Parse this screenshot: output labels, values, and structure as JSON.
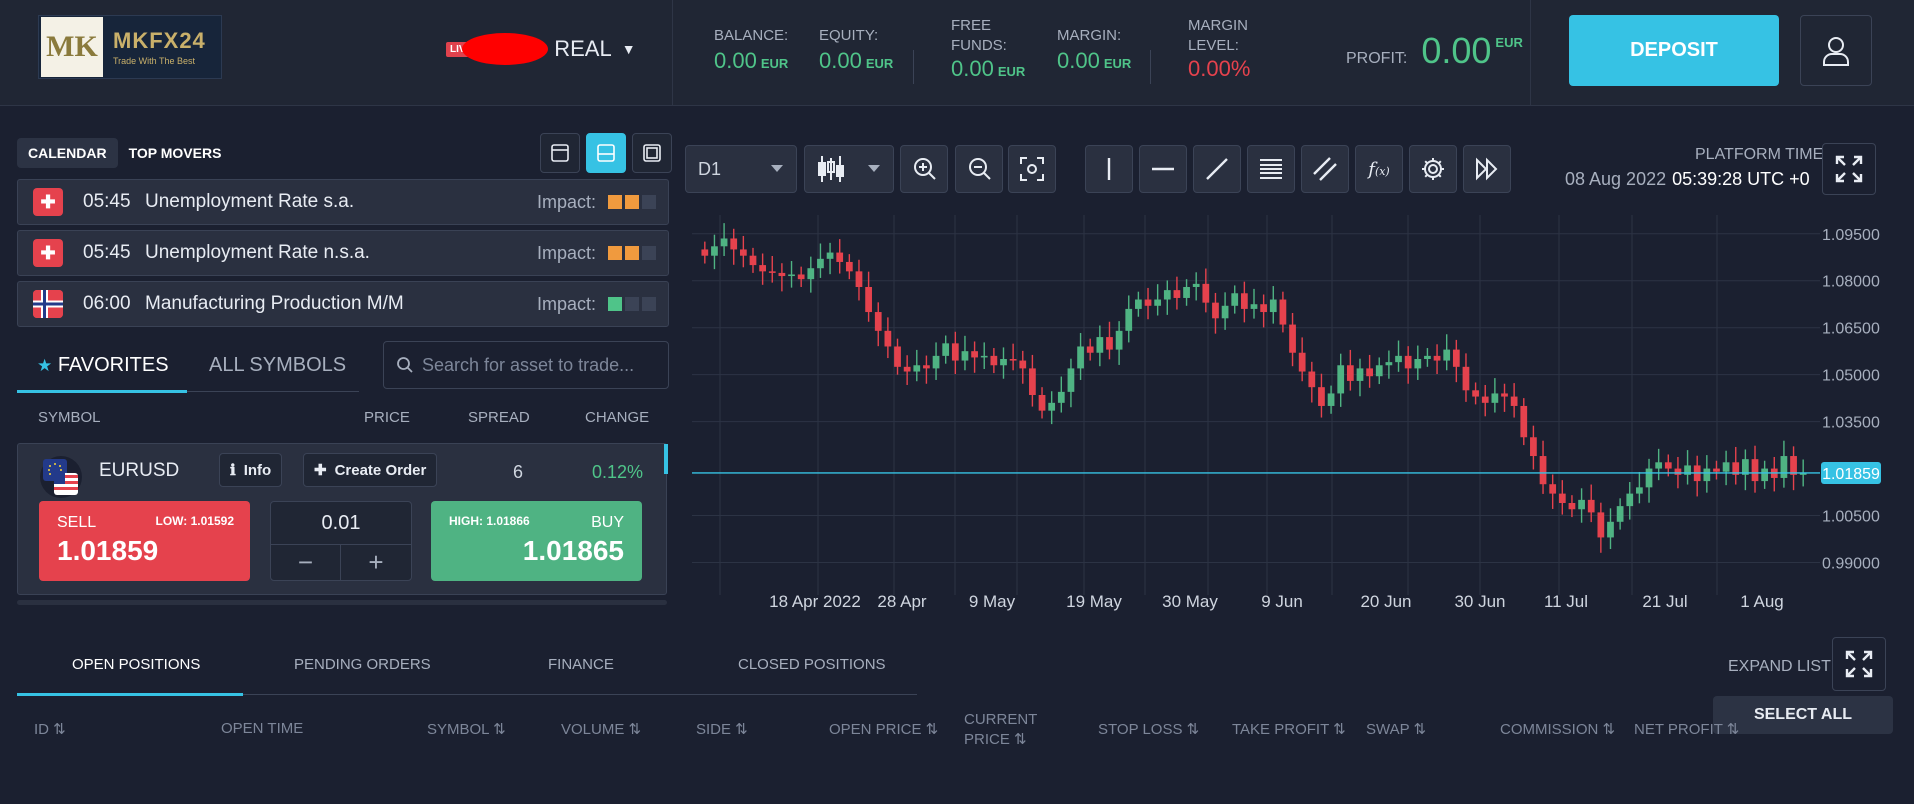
{
  "logo": {
    "title": "MKFX24",
    "tagline": "Trade With The Best",
    "mark": "MK"
  },
  "account": {
    "badge": "LIVE",
    "type": "REAL",
    "caret": "▼"
  },
  "stats": {
    "balance": {
      "label": "BALANCE:",
      "value": "0.00",
      "currency": "EUR"
    },
    "equity": {
      "label": "EQUITY:",
      "value": "0.00",
      "currency": "EUR"
    },
    "free_funds": {
      "label1": "FREE",
      "label2": "FUNDS:",
      "value": "0.00",
      "currency": "EUR"
    },
    "margin": {
      "label": "MARGIN:",
      "value": "0.00",
      "currency": "EUR"
    },
    "margin_level": {
      "label1": "MARGIN",
      "label2": "LEVEL:",
      "value": "0.00%"
    },
    "profit": {
      "label": "PROFIT:",
      "value": "0.00",
      "currency": "EUR"
    }
  },
  "deposit_label": "DEPOSIT",
  "left_tabs": {
    "calendar": "CALENDAR",
    "top_movers": "TOP MOVERS"
  },
  "events": [
    {
      "time": "05:45",
      "name": "Unemployment Rate s.a.",
      "impact_label": "Impact:",
      "impact_level": 2,
      "color": "#f09a3e"
    },
    {
      "time": "05:45",
      "name": "Unemployment Rate n.s.a.",
      "impact_label": "Impact:",
      "impact_level": 2,
      "color": "#f09a3e"
    },
    {
      "time": "06:00",
      "name": "Manufacturing Production M/M",
      "impact_label": "Impact:",
      "impact_level": 1,
      "color": "#4fc489"
    }
  ],
  "symbol_tabs": {
    "favorites": "FAVORITES",
    "all": "ALL SYMBOLS"
  },
  "search": {
    "placeholder": "Search for asset to trade..."
  },
  "columns": {
    "symbol": "SYMBOL",
    "price": "PRICE",
    "spread": "SPREAD",
    "change": "CHANGE"
  },
  "instrument": {
    "symbol": "EURUSD",
    "info_label": "Info",
    "create_order_label": "Create Order",
    "spread": "6",
    "change": "0.12%",
    "sell_label": "SELL",
    "low_label": "LOW: 1.01592",
    "sell_price": "1.01859",
    "quantity": "0.01",
    "minus": "−",
    "plus": "+",
    "high_label": "HIGH: 1.01866",
    "buy_label": "BUY",
    "buy_price": "1.01865"
  },
  "chart_toolbar": {
    "timeframe": "D1"
  },
  "platform_time": {
    "label": "PLATFORM TIME",
    "date": "08 Aug 2022",
    "time": "05:39:28 UTC +0"
  },
  "chart_data": {
    "type": "candlestick",
    "x_ticks": [
      "18 Apr 2022",
      "28 Apr",
      "9 May",
      "19 May",
      "30 May",
      "9 Jun",
      "20 Jun",
      "30 Jun",
      "11 Jul",
      "21 Jul",
      "1 Aug"
    ],
    "y_ticks": [
      "1.09500",
      "1.08000",
      "1.06500",
      "1.05000",
      "1.03500",
      "1.00500",
      "0.99000"
    ],
    "ylim": [
      0.986,
      1.101
    ],
    "current_price": "1.01859",
    "current_price_value": 1.01859,
    "up_color": "#4fb383",
    "down_color": "#e5424d",
    "closes": [
      1.088,
      1.091,
      1.0935,
      1.09,
      1.088,
      1.085,
      1.083,
      1.0825,
      1.0815,
      1.082,
      1.0805,
      1.084,
      1.087,
      1.089,
      1.086,
      1.083,
      1.078,
      1.07,
      1.064,
      1.059,
      1.0525,
      1.051,
      1.053,
      1.052,
      1.056,
      1.06,
      1.0545,
      1.0575,
      1.0555,
      1.056,
      1.053,
      1.055,
      1.0545,
      1.052,
      1.0435,
      1.0385,
      1.041,
      1.0445,
      1.052,
      1.059,
      1.057,
      1.062,
      1.058,
      1.064,
      1.071,
      1.074,
      1.072,
      1.074,
      1.077,
      1.0745,
      1.078,
      1.079,
      1.073,
      1.068,
      1.072,
      1.076,
      1.071,
      1.0725,
      1.07,
      1.074,
      1.066,
      1.057,
      1.051,
      1.046,
      1.04,
      1.044,
      1.053,
      1.048,
      1.052,
      1.0495,
      1.053,
      1.054,
      1.056,
      1.052,
      1.055,
      1.056,
      1.0545,
      1.058,
      1.0525,
      1.045,
      1.043,
      1.041,
      1.044,
      1.043,
      1.04,
      1.03,
      1.024,
      1.015,
      1.012,
      1.009,
      1.007,
      1.01,
      1.006,
      0.998,
      1.003,
      1.008,
      1.012,
      1.014,
      1.02,
      1.022,
      1.02,
      1.018,
      1.021,
      1.016,
      1.02,
      1.019,
      1.022,
      1.018,
      1.023,
      1.016,
      1.02,
      1.017,
      1.024,
      1.018,
      1.0186
    ]
  },
  "bottom_tabs": [
    "OPEN POSITIONS",
    "PENDING ORDERS",
    "FINANCE",
    "CLOSED POSITIONS"
  ],
  "expand_list": "EXPAND LIST",
  "select_all": "SELECT ALL",
  "table_headers": {
    "id": "ID ⇅",
    "open_time": "OPEN TIME",
    "symbol": "SYMBOL ⇅",
    "volume": "VOLUME ⇅",
    "side": "SIDE ⇅",
    "open_price": "OPEN PRICE ⇅",
    "current_price_1": "CURRENT",
    "current_price_2": "PRICE ⇅",
    "stop_loss": "STOP LOSS ⇅",
    "take_profit": "TAKE PROFIT ⇅",
    "swap": "SWAP ⇅",
    "commission": "COMMISSION ⇅",
    "net_profit": "NET PROFIT ⇅"
  }
}
